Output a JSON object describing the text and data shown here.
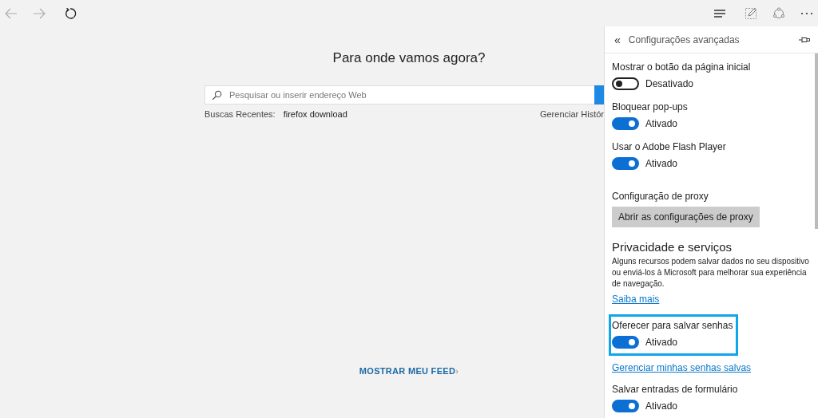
{
  "main": {
    "title": "Para onde vamos agora?",
    "search": {
      "placeholder": "Pesquisar ou inserir endereço Web"
    },
    "recent_label": "Buscas Recentes:",
    "recent_item": "firefox download",
    "manage_history": "Gerenciar Histór",
    "feed_link": "MOSTRAR MEU FEED",
    "feed_chevron": "›"
  },
  "panel": {
    "back": "«",
    "title": "Configurações avançadas",
    "items": [
      {
        "kind": "toggle",
        "label": "Mostrar o botão da página inicial",
        "on": false,
        "state": "Desativado",
        "highlighted": false
      },
      {
        "kind": "toggle",
        "label": "Bloquear pop-ups",
        "on": true,
        "state": "Ativado",
        "highlighted": false
      },
      {
        "kind": "toggle",
        "label": "Usar o Adobe Flash Player",
        "on": true,
        "state": "Ativado",
        "highlighted": false
      },
      {
        "kind": "button",
        "label": "Configuração de proxy",
        "button": "Abrir as configurações de proxy"
      },
      {
        "kind": "heading",
        "label": "Privacidade e serviços",
        "text": "Alguns recursos podem salvar dados no seu dispositivo ou enviá-los à Microsoft para melhorar sua experiência de navegação."
      },
      {
        "kind": "link",
        "label": "Saiba mais"
      },
      {
        "kind": "toggle",
        "label": "Oferecer para salvar senhas",
        "on": true,
        "state": "Ativado",
        "highlighted": true
      },
      {
        "kind": "link",
        "label": "Gerenciar minhas senhas salvas"
      },
      {
        "kind": "toggle",
        "label": "Salvar entradas de formulário",
        "on": true,
        "state": "Ativado",
        "highlighted": false
      }
    ]
  }
}
